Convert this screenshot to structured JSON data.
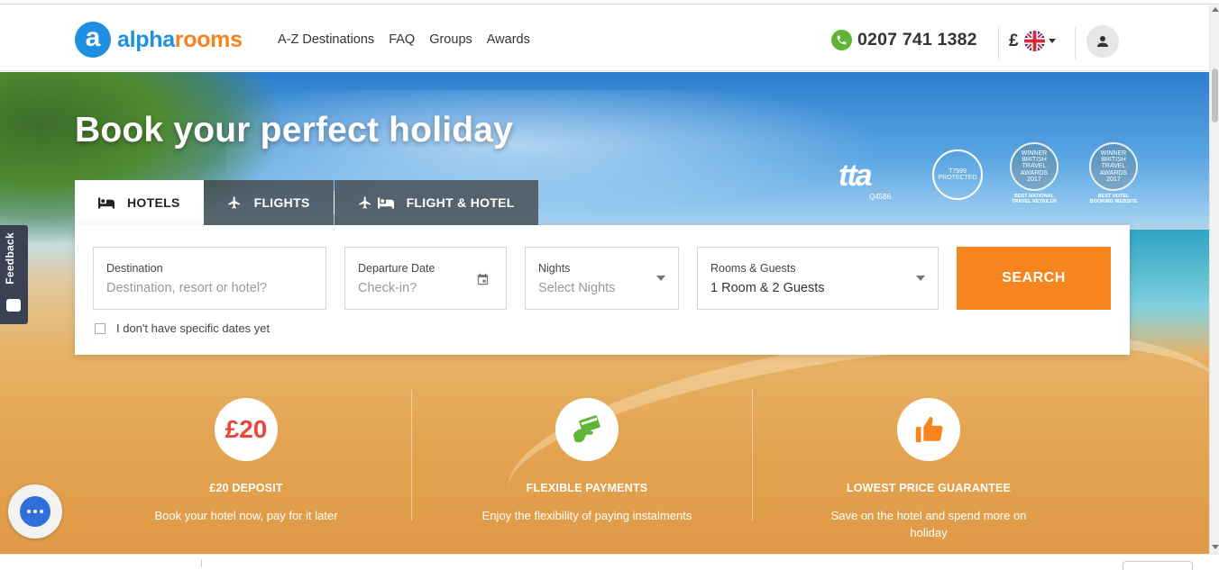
{
  "brand": {
    "logo_letter": "a",
    "name_part1": "alpha",
    "name_part2": "rooms",
    "blue": "#1e8fe1",
    "orange": "#f5841f"
  },
  "nav": {
    "items": [
      "A-Z Destinations",
      "FAQ",
      "Groups",
      "Awards"
    ]
  },
  "contact": {
    "phone": "0207 741 1382",
    "phone_icon": "phone-icon"
  },
  "currency": {
    "symbol": "£",
    "flag": "uk-flag-icon"
  },
  "hero": {
    "title": "Book your perfect holiday"
  },
  "badges": {
    "tta": {
      "word": "tta",
      "number": "Q4586"
    },
    "atol": {
      "number": "T7599",
      "text": "PROTECTED"
    },
    "awards": [
      {
        "top": "WINNER",
        "mid": "BRITISH TRAVEL AWARDS 2017",
        "sub": "BEST NATIONAL TRAVEL RETAILER"
      },
      {
        "top": "WINNER",
        "mid": "BRITISH TRAVEL AWARDS 2017",
        "sub": "BEST HOTEL BOOKING WEBSITE"
      }
    ]
  },
  "tabs": [
    {
      "label": "HOTELS",
      "icon": "bed-icon",
      "active": true
    },
    {
      "label": "FLIGHTS",
      "icon": "plane-icon",
      "active": false
    },
    {
      "label": "FLIGHT & HOTEL",
      "icon": "plane-bed-icon",
      "active": false
    }
  ],
  "search": {
    "destination": {
      "label": "Destination",
      "placeholder": "Destination, resort or hotel?"
    },
    "departure": {
      "label": "Departure Date",
      "placeholder": "Check-in?"
    },
    "nights": {
      "label": "Nights",
      "placeholder": "Select Nights"
    },
    "guests": {
      "label": "Rooms & Guests",
      "value": "1 Room & 2 Guests"
    },
    "button": "SEARCH",
    "no_dates": "I don't have specific dates yet"
  },
  "features": [
    {
      "icon": "£20",
      "title": "£20 DEPOSIT",
      "desc": "Book your hotel now, pay for it later"
    },
    {
      "icon": "card-payment-icon",
      "title": "FLEXIBLE PAYMENTS",
      "desc": "Enjoy the flexibility of paying instalments"
    },
    {
      "icon": "thumbs-up-icon",
      "title": "LOWEST PRICE GUARANTEE",
      "desc": "Save on the hotel and spend more on holiday"
    }
  ],
  "feedback": {
    "label": "Feedback"
  },
  "colors": {
    "search_button": "#f7851f",
    "green_phone": "#5fb436",
    "feature_red": "#e8473a",
    "feature_green": "#5fb436",
    "feature_orange": "#f7851f"
  }
}
